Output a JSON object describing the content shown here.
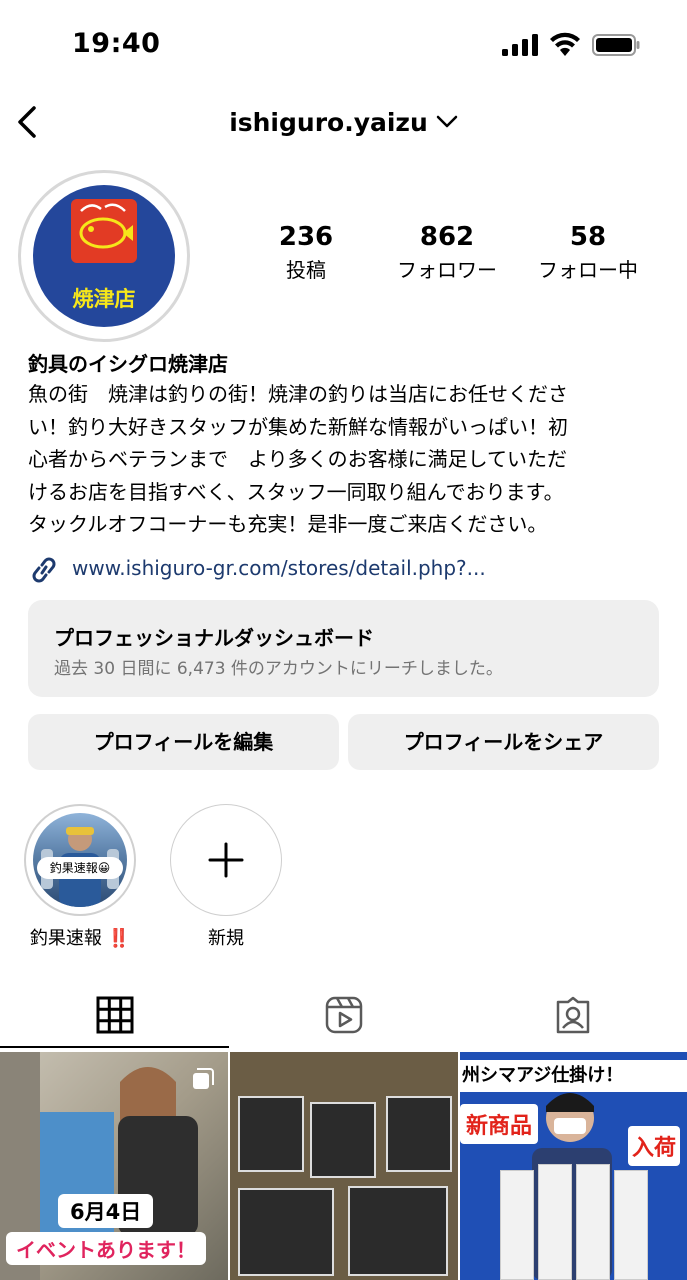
{
  "status_bar": {
    "time": "19:40"
  },
  "nav": {
    "username": "ishiguro.yaizu"
  },
  "avatar": {
    "store_label": "焼津店"
  },
  "stats": [
    {
      "value": "236",
      "label": "投稿"
    },
    {
      "value": "862",
      "label": "フォロワー"
    },
    {
      "value": "58",
      "label": "フォロー中"
    }
  ],
  "profile": {
    "name": "釣具のイシグロ焼津店",
    "bio_lines": [
      "魚の街　焼津は釣りの街！焼津の釣りは当店にお任せくださ",
      "い！釣り大好きスタッフが集めた新鮮な情報がいっぱい！初",
      "心者からベテランまで　より多くのお客様に満足していただ",
      "けるお店を目指すべく、スタッフ一同取り組んでおります。",
      "タックルオフコーナーも充実！是非一度ご来店ください。"
    ],
    "link": "www.ishiguro-gr.com/stores/detail.php?..."
  },
  "dashboard": {
    "title": "プロフェッショナルダッシュボード",
    "subtitle": "過去 30 日間に 6,473 件のアカウントにリーチしました。"
  },
  "buttons": {
    "edit": "プロフィールを編集",
    "share": "プロフィールをシェア"
  },
  "highlights": [
    {
      "label": "釣果速報 ‼️",
      "tag": "釣果速報😀"
    },
    {
      "label": "新規"
    }
  ],
  "tabs": [
    "grid-icon",
    "reels-icon",
    "tagged-icon"
  ],
  "posts": [
    {
      "date": "6月4日",
      "caption": "イベントあります！"
    },
    {
      "caption": ""
    },
    {
      "header": "州シマアジ仕掛け！",
      "badge_new": "新商品",
      "badge_arrive": "入荷"
    }
  ]
}
